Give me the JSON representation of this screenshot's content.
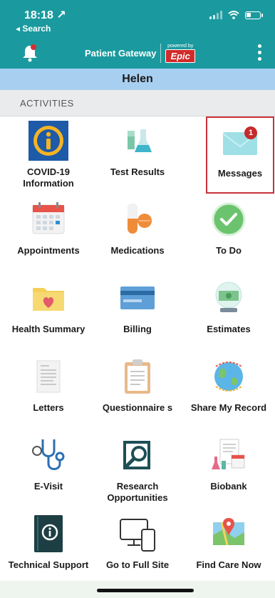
{
  "status": {
    "time": "18:18 ↗",
    "back": "◂ Search"
  },
  "header": {
    "title": "Patient Gateway",
    "powered_by": "powered by",
    "brand": "Epic"
  },
  "user": {
    "name": "Helen"
  },
  "section": {
    "title": "ACTIVITIES"
  },
  "tiles": [
    {
      "label": "COVID-19 Information",
      "icon": "covid-info-icon"
    },
    {
      "label": "Test Results",
      "icon": "test-tubes-icon"
    },
    {
      "label": "Messages",
      "icon": "envelope-icon",
      "badge": "1"
    },
    {
      "label": "Appointments",
      "icon": "calendar-icon"
    },
    {
      "label": "Medications",
      "icon": "pills-icon"
    },
    {
      "label": "To Do",
      "icon": "checkmark-icon"
    },
    {
      "label": "Health Summary",
      "icon": "folder-heart-icon"
    },
    {
      "label": "Billing",
      "icon": "credit-card-icon"
    },
    {
      "label": "Estimates",
      "icon": "money-globe-icon"
    },
    {
      "label": "Letters",
      "icon": "letter-icon"
    },
    {
      "label": "Questionnaire s",
      "icon": "clipboard-icon"
    },
    {
      "label": "Share My Record",
      "icon": "globe-share-icon"
    },
    {
      "label": "E-Visit",
      "icon": "stethoscope-icon"
    },
    {
      "label": "Research Opportunities",
      "icon": "research-magnifier-icon"
    },
    {
      "label": "Biobank",
      "icon": "biobank-icon"
    },
    {
      "label": "Technical Support",
      "icon": "tech-support-icon"
    },
    {
      "label": "Go to Full Site",
      "icon": "devices-icon"
    },
    {
      "label": "Find Care Now",
      "icon": "map-pin-icon"
    }
  ],
  "colors": {
    "header": "#1a9a9f",
    "user_bar": "#a9cff0",
    "highlight": "#c8323a",
    "badge": "#c62a2a"
  }
}
